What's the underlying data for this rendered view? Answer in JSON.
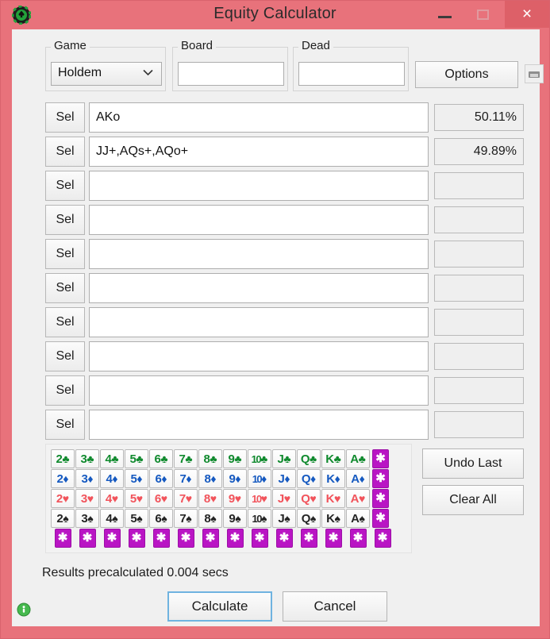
{
  "window": {
    "title": "Equity Calculator",
    "app_icon": "poker-chip-icon",
    "minimize_label": "—",
    "maximize_label": "",
    "close_label": "×",
    "frame_color": "#e8727b",
    "client_color": "#f0f0f0"
  },
  "toolbar": {
    "game": {
      "label": "Game",
      "value": "Holdem",
      "chevron": "⌄"
    },
    "board": {
      "label": "Board",
      "value": "",
      "placeholder": ""
    },
    "dead": {
      "label": "Dead",
      "value": "",
      "placeholder": ""
    },
    "options_label": "Options",
    "save_icon": "disk-icon"
  },
  "rows": [
    {
      "sel_label": "Sel",
      "range": "AKo",
      "equity": "50.11%"
    },
    {
      "sel_label": "Sel",
      "range": "JJ+,AQs+,AQo+",
      "equity": "49.89%"
    },
    {
      "sel_label": "Sel",
      "range": "",
      "equity": ""
    },
    {
      "sel_label": "Sel",
      "range": "",
      "equity": ""
    },
    {
      "sel_label": "Sel",
      "range": "",
      "equity": ""
    },
    {
      "sel_label": "Sel",
      "range": "",
      "equity": ""
    },
    {
      "sel_label": "Sel",
      "range": "",
      "equity": ""
    },
    {
      "sel_label": "Sel",
      "range": "",
      "equity": ""
    },
    {
      "sel_label": "Sel",
      "range": "",
      "equity": ""
    },
    {
      "sel_label": "Sel",
      "range": "",
      "equity": ""
    }
  ],
  "cards": {
    "ranks": [
      "2",
      "3",
      "4",
      "5",
      "6",
      "7",
      "8",
      "9",
      "10",
      "J",
      "Q",
      "K",
      "A"
    ],
    "suits": [
      {
        "key": "c",
        "name": "clubs",
        "glyph": "♣",
        "color": "#108a2e"
      },
      {
        "key": "d",
        "name": "diamonds",
        "glyph": "♦",
        "color": "#1559c0"
      },
      {
        "key": "h",
        "name": "hearts",
        "glyph": "♥",
        "color": "#f1535b"
      },
      {
        "key": "s",
        "name": "spades",
        "glyph": "♠",
        "color": "#242424"
      }
    ],
    "wild_glyph": "✱",
    "wild_color": "#b915c4",
    "wild_row_count": 14,
    "undo_label": "Undo Last",
    "clear_label": "Clear All"
  },
  "footer": {
    "status": "Results precalculated 0.004 secs",
    "calculate_label": "Calculate",
    "cancel_label": "Cancel",
    "status_icon": "green-info-icon"
  }
}
